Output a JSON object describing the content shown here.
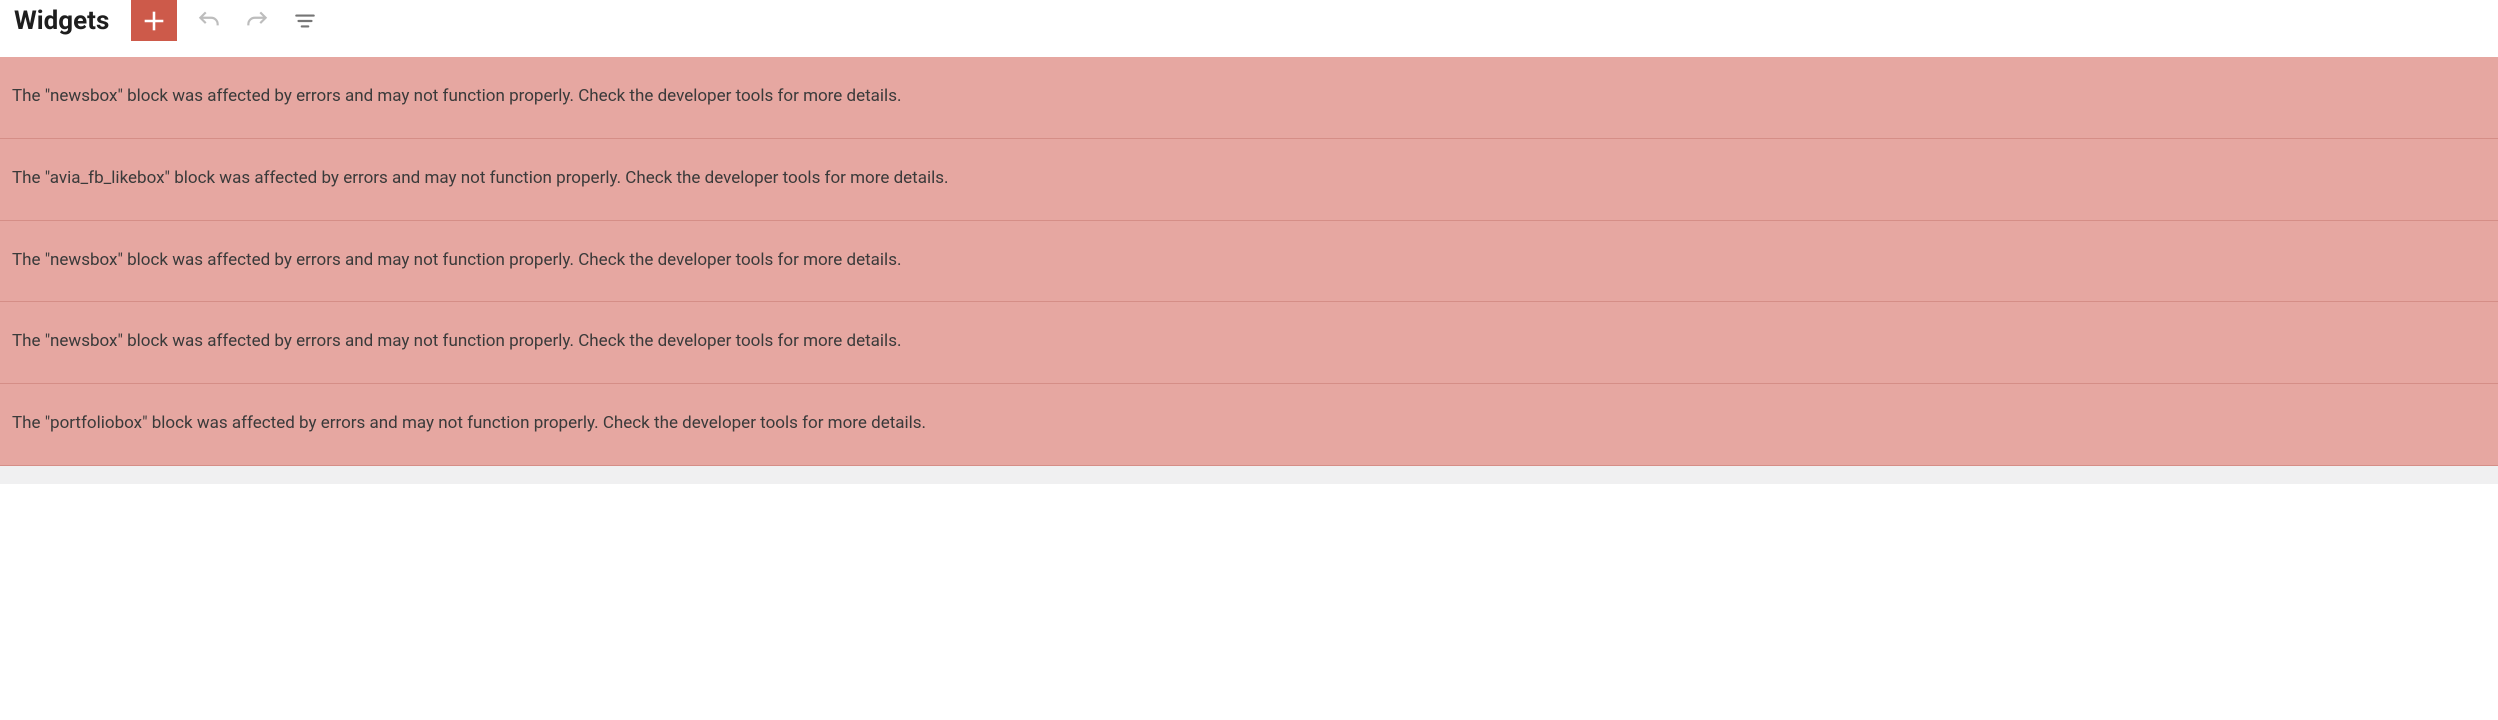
{
  "header": {
    "title": "Widgets"
  },
  "toolbar": {
    "add_label": "Add",
    "undo_label": "Undo",
    "redo_label": "Redo",
    "outline_label": "Outline"
  },
  "errors": [
    {
      "message": "The \"newsbox\" block was affected by errors and may not function properly. Check the developer tools for more details."
    },
    {
      "message": "The \"avia_fb_likebox\" block was affected by errors and may not function properly. Check the developer tools for more details."
    },
    {
      "message": "The \"newsbox\" block was affected by errors and may not function properly. Check the developer tools for more details."
    },
    {
      "message": "The \"newsbox\" block was affected by errors and may not function properly. Check the developer tools for more details."
    },
    {
      "message": "The \"portfoliobox\" block was affected by errors and may not function properly. Check the developer tools for more details."
    }
  ]
}
